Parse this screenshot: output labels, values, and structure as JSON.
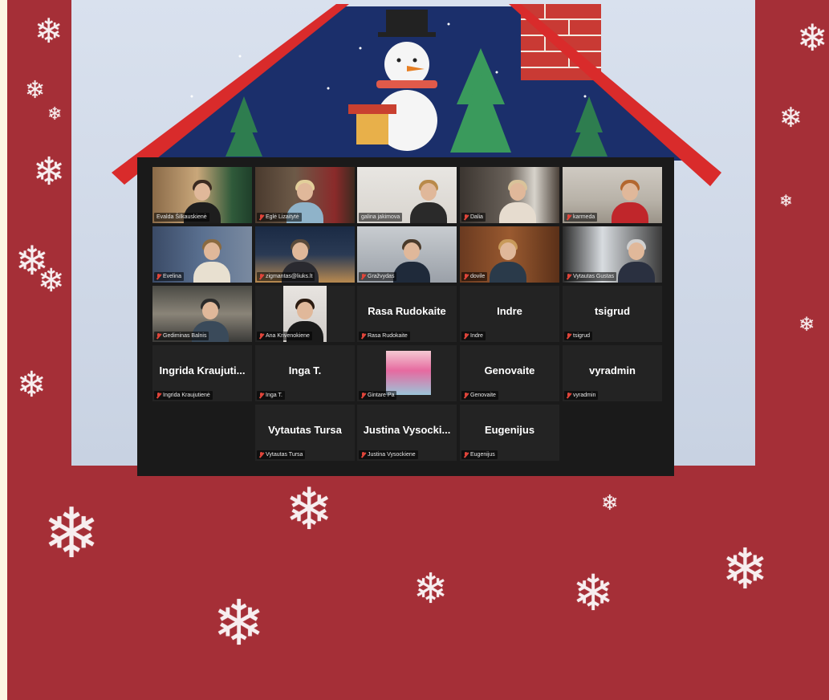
{
  "participants": [
    {
      "name": "Evalda Šilkauskienė",
      "type": "video",
      "muted": false,
      "active": false
    },
    {
      "name": "Eglė Lizaitytė",
      "type": "video",
      "muted": true,
      "active": false
    },
    {
      "name": "galina jakimova",
      "type": "video",
      "muted": false,
      "active": true
    },
    {
      "name": "Dalia",
      "type": "video",
      "muted": true,
      "active": false
    },
    {
      "name": "karmeda",
      "type": "video",
      "muted": true,
      "active": false
    },
    {
      "name": "Evelina",
      "type": "video",
      "muted": true,
      "active": false
    },
    {
      "name": "zigmantas@liuks.lt",
      "type": "video",
      "muted": true,
      "active": false
    },
    {
      "name": "Gražvydas",
      "type": "video",
      "muted": true,
      "active": false
    },
    {
      "name": "dovile",
      "type": "video",
      "muted": true,
      "active": false
    },
    {
      "name": "Vytautas Gustas",
      "type": "video",
      "muted": true,
      "active": false
    },
    {
      "name": "Gediminas Balnis",
      "type": "video",
      "muted": true,
      "active": false
    },
    {
      "name": "Ana Krivenokiene",
      "type": "video",
      "muted": true,
      "active": false
    },
    {
      "name": "Rasa Rudokaite",
      "display": "Rasa Rudokaite",
      "type": "name",
      "muted": true,
      "active": false
    },
    {
      "name": "Indre",
      "display": "Indre",
      "type": "name",
      "muted": true,
      "active": false
    },
    {
      "name": "tsigrud",
      "display": "tsigrud",
      "type": "name",
      "muted": true,
      "active": false
    },
    {
      "name": "Ingrida Kraujutienė",
      "display": "Ingrida  Kraujuti...",
      "type": "name",
      "muted": true,
      "active": false
    },
    {
      "name": "Inga T.",
      "display": "Inga T.",
      "type": "name",
      "muted": true,
      "active": false
    },
    {
      "name": "Gintare Pa",
      "type": "photo",
      "muted": true,
      "active": false
    },
    {
      "name": "Genovaite",
      "display": "Genovaite",
      "type": "name",
      "muted": true,
      "active": false
    },
    {
      "name": "vyradmin",
      "display": "vyradmin",
      "type": "name",
      "muted": true,
      "active": false
    },
    {
      "name": "Vytautas Tursa",
      "display": "Vytautas Tursa",
      "type": "name",
      "muted": true,
      "active": false
    },
    {
      "name": "Justina Vysockiene",
      "display": "Justina  Vysocki...",
      "type": "name",
      "muted": true,
      "active": false
    },
    {
      "name": "Eugenijus",
      "display": "Eugenijus",
      "type": "name",
      "muted": true,
      "active": false
    }
  ],
  "colors": {
    "background": "#a52f37",
    "roof": "#d92b2b",
    "night_sky": "#1b2f6b",
    "active_speaker": "#b8d94a",
    "muted_icon": "#e0453a",
    "gallery_background": "#1a1a1a",
    "tile_background": "#232323"
  },
  "icons": {
    "muted": "microphone-muted-icon",
    "decoration": "snowflake-icon"
  }
}
